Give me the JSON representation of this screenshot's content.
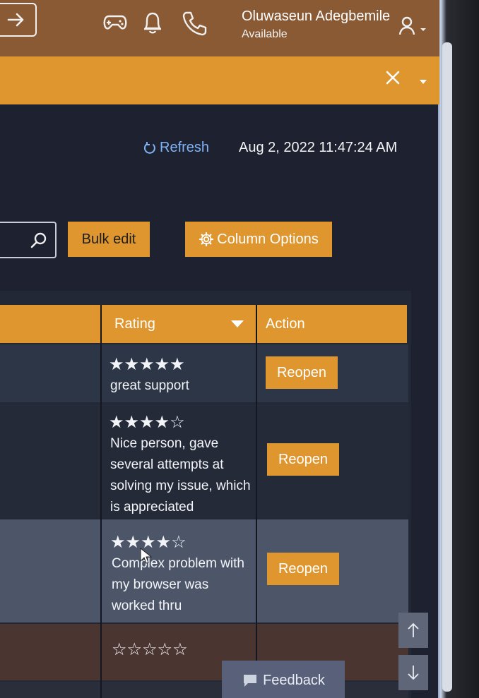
{
  "header": {
    "user_name": "Oluwaseun Adegbemile",
    "user_status": "Available",
    "icons": [
      "arrow-right-icon",
      "gamepad-icon",
      "bell-icon",
      "phone-icon",
      "user-icon"
    ]
  },
  "banner": {
    "close_glyph": "✕",
    "caret_glyph": "▾"
  },
  "toolbar": {
    "refresh_label": "Refresh",
    "timestamp": "Aug 2, 2022 11:47:24 AM",
    "bulk_edit_label": "Bulk edit",
    "column_options_label": "Column Options"
  },
  "table": {
    "columns": [
      "Rating",
      "Action"
    ],
    "rows": [
      {
        "stars": "★★★★★",
        "rating": 5,
        "comment": "great support",
        "action": "Reopen"
      },
      {
        "stars": "★★★★☆",
        "rating": 4,
        "comment": "Nice person, gave several attempts at solving my issue, which is appreciated",
        "action": "Reopen"
      },
      {
        "stars": "★★★★☆",
        "rating": 4,
        "comment": "Complex problem with my browser was worked thru",
        "action": "Reopen"
      },
      {
        "stars": "☆☆☆☆☆",
        "rating": 0,
        "comment": "",
        "action": ""
      }
    ]
  },
  "feedback_label": "Feedback",
  "colors": {
    "accent": "#e0962e",
    "topbar": "#8a5a35",
    "background": "#1e2130",
    "link": "#7fb3f5"
  }
}
